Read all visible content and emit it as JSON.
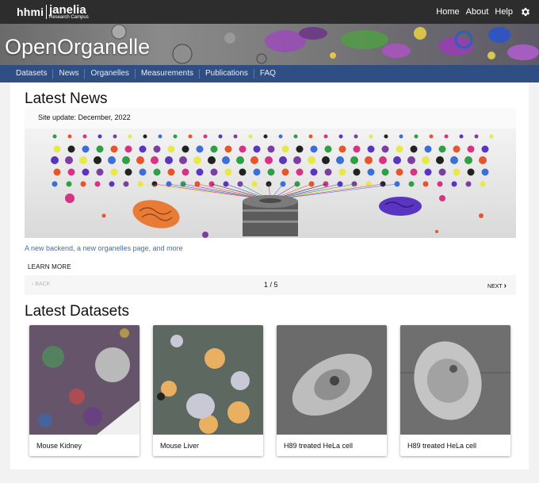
{
  "topbar": {
    "logo_hhmi": "hhmi",
    "logo_janelia": "janelia",
    "logo_subtitle": "Research Campus",
    "links": [
      "Home",
      "About",
      "Help"
    ],
    "settings_icon": "gear-icon"
  },
  "banner": {
    "title": "OpenOrganelle"
  },
  "nav": {
    "items": [
      "Datasets",
      "News",
      "Organelles",
      "Measurements",
      "Publications",
      "FAQ"
    ]
  },
  "news": {
    "heading": "Latest News",
    "site_update": "Site update: December, 2022",
    "link_text": "A new backend, a new organelles page, and more",
    "learn_more": "LEARN MORE",
    "back": "BACK",
    "page_indicator": "1 / 5",
    "next": "NEXT"
  },
  "datasets": {
    "heading": "Latest Datasets",
    "cards": [
      {
        "label": "Mouse Kidney"
      },
      {
        "label": "Mouse Liver"
      },
      {
        "label": "H89 treated HeLa cell"
      },
      {
        "label": "H89 treated HeLa cell"
      }
    ]
  },
  "colors": {
    "topbar": "#2d2d2d",
    "nav": "#2e4e84",
    "link": "#3e6fb0"
  }
}
